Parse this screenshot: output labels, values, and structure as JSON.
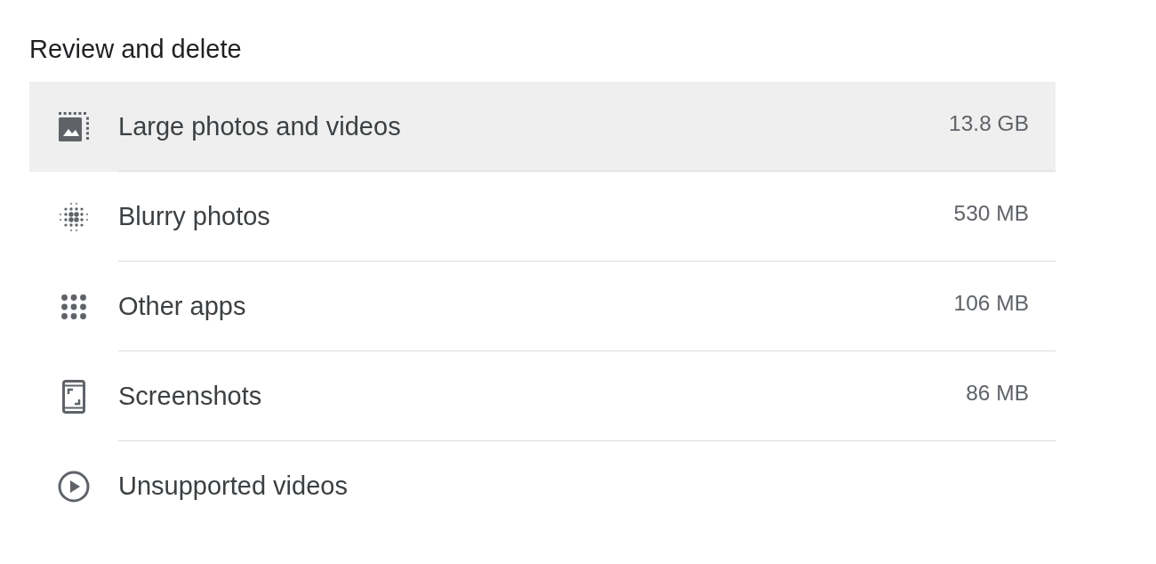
{
  "section": {
    "title": "Review and delete"
  },
  "items": [
    {
      "kind": "large",
      "label": "Large photos and videos",
      "size": "13.8 GB",
      "selected": true
    },
    {
      "kind": "blurry",
      "label": "Blurry photos",
      "size": "530 MB",
      "selected": false
    },
    {
      "kind": "apps",
      "label": "Other apps",
      "size": "106 MB",
      "selected": false
    },
    {
      "kind": "screenshots",
      "label": "Screenshots",
      "size": "86 MB",
      "selected": false
    },
    {
      "kind": "videos",
      "label": "Unsupported videos",
      "selected": false
    }
  ]
}
